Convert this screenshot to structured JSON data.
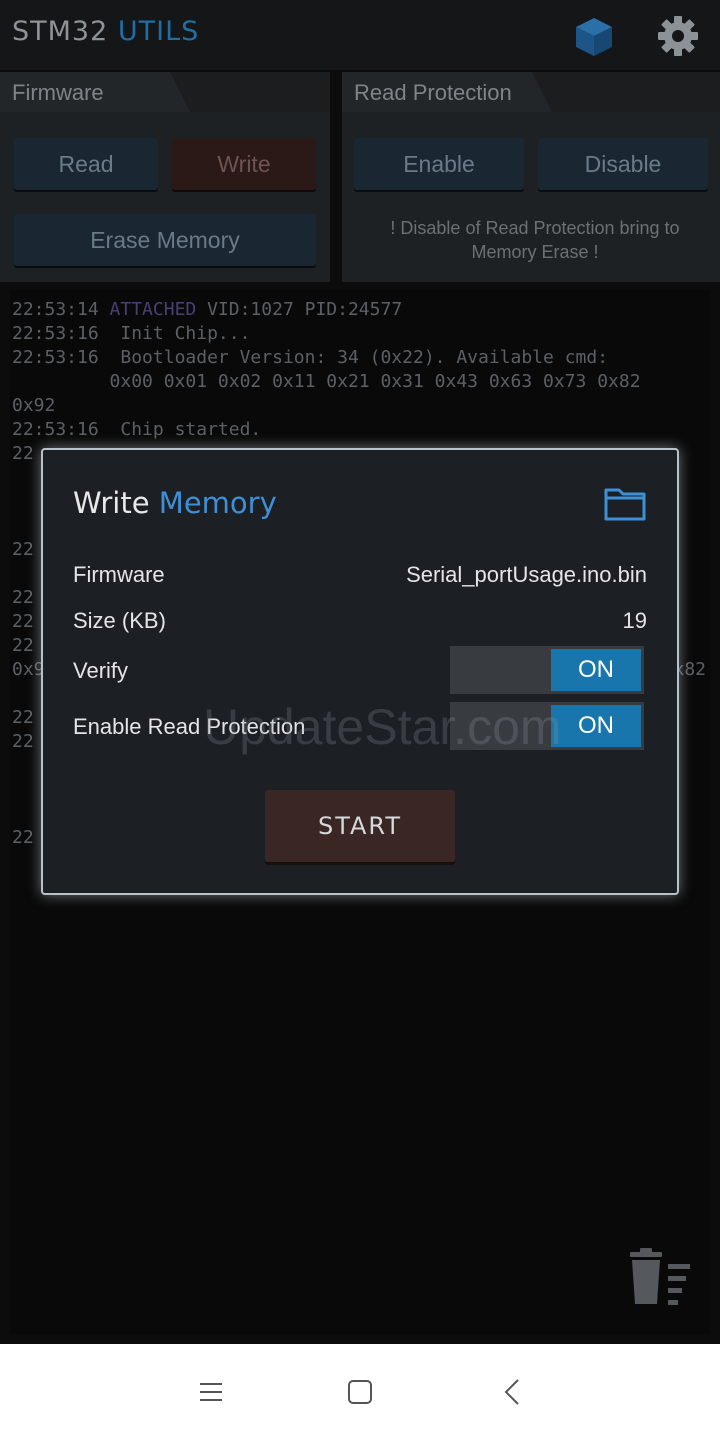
{
  "appbar": {
    "title_part1": "STM32",
    "title_part2": "UTILS",
    "icons": [
      "cube-icon",
      "gear-icon"
    ]
  },
  "firmware_panel": {
    "tab_label": "Firmware",
    "read_label": "Read",
    "write_label": "Write",
    "erase_label": "Erase Memory"
  },
  "read_protection_panel": {
    "tab_label": "Read Protection",
    "enable_label": "Enable",
    "disable_label": "Disable",
    "note": "! Disable of Read Protection bring to Memory Erase !"
  },
  "console": {
    "lines": [
      {
        "time": "22:53:14",
        "highlight": "ATTACHED",
        "text": " VID:1027 PID:24577"
      },
      {
        "time": "22:53:16",
        "highlight": "",
        "text": " Init Chip..."
      },
      {
        "time": "22:53:16",
        "highlight": "",
        "text": " Bootloader Version: 34 (0x22). Available cmd:"
      },
      {
        "time": "",
        "highlight": "",
        "text": "         0x00 0x01 0x02 0x11 0x21 0x31 0x43 0x63 0x73 0x82"
      },
      {
        "time": "",
        "highlight": "",
        "text": "0x92"
      },
      {
        "time": "22:53:16",
        "highlight": "",
        "text": " Chip started."
      },
      {
        "time": "",
        "highlight": "",
        "text": "22"
      },
      {
        "time": "",
        "highlight": "",
        "text": "22"
      },
      {
        "time": "",
        "highlight": "",
        "text": "22"
      },
      {
        "time": "",
        "highlight": "",
        "text": "22"
      },
      {
        "time": "",
        "highlight": "",
        "text": "22"
      },
      {
        "time": "",
        "highlight": "",
        "text": "0x9"
      },
      {
        "time": "",
        "highlight": "",
        "text": "22"
      },
      {
        "time": "",
        "highlight": "",
        "text": "22"
      },
      {
        "time": "",
        "highlight": "",
        "text": "22"
      },
      {
        "time": "",
        "highlight": "",
        "text": "x82"
      }
    ],
    "trash_icon": "trash-clear-icon"
  },
  "dialog": {
    "title_part1": "Write",
    "title_part2": "Memory",
    "folder_icon": "folder-icon",
    "firmware_label": "Firmware",
    "firmware_value": "Serial_portUsage.ino.bin",
    "size_label": "Size (KB)",
    "size_value": "19",
    "verify_label": "Verify",
    "verify_state": "ON",
    "read_protection_label": "Enable Read Protection",
    "read_protection_state": "ON",
    "start_label": "START",
    "watermark": "UpdateStar.com"
  },
  "navbar": {
    "icons": [
      "menu-icon",
      "home-icon",
      "back-icon"
    ]
  },
  "colors": {
    "accent_blue": "#3f8fd6",
    "toggle_on": "#1876ad",
    "start_button": "#3a2622",
    "dialog_border": "#b9c2cc"
  }
}
